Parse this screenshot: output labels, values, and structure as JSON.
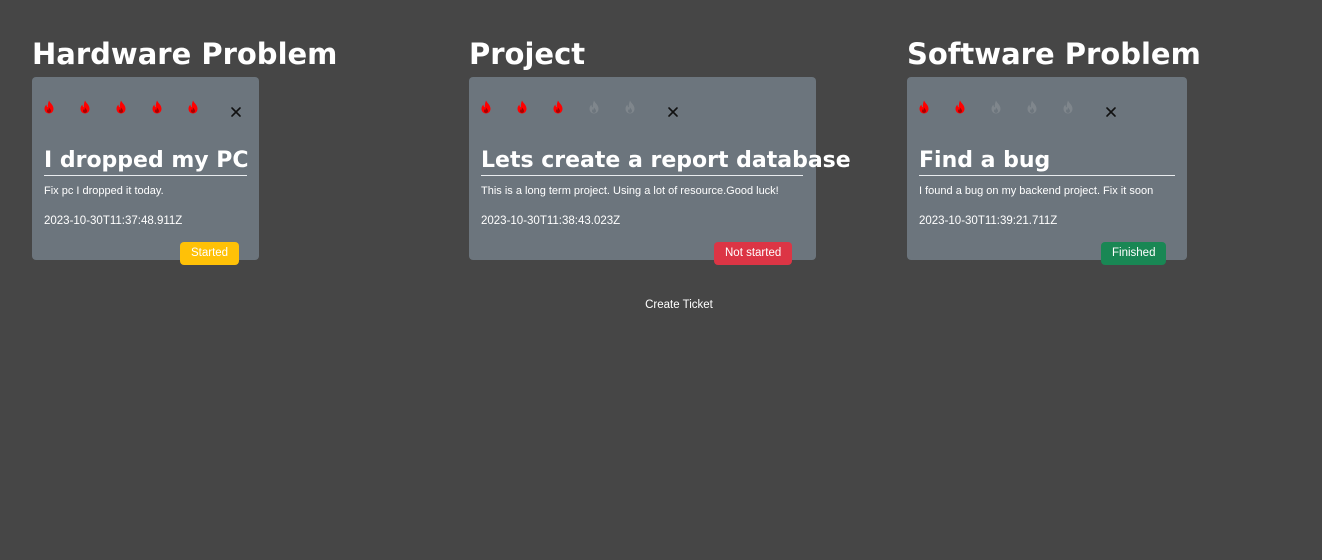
{
  "columns": [
    {
      "title": "Hardware Problem",
      "ticket": {
        "title": "I dropped my PC",
        "description": "Fix pc I dropped it today.",
        "date": "2023-10-30T11:37:48.911Z",
        "status": "Started",
        "priority": 5,
        "max_priority": 5
      }
    },
    {
      "title": "Project",
      "ticket": {
        "title": "Lets create a report database",
        "description": "This is a long term project. Using a lot of resource.Good luck!",
        "date": "2023-10-30T11:38:43.023Z",
        "status": "Not started",
        "priority": 3,
        "max_priority": 5
      }
    },
    {
      "title": "Software Problem",
      "ticket": {
        "title": "Find a bug",
        "description": "I found a bug on my backend project. Fix it soon",
        "date": "2023-10-30T11:39:21.711Z",
        "status": "Finished",
        "priority": 2,
        "max_priority": 5
      }
    }
  ],
  "icons": {
    "priority": "flame-icon",
    "close": "close-icon"
  },
  "colors": {
    "background": "#464646",
    "card": "#6c757d",
    "flame_active": "#ff0000",
    "flame_inactive": "#7f868c",
    "status_started": "#ffc107",
    "status_not_started": "#dc3545",
    "status_finished": "#198754"
  },
  "create_ticket_label": "Create Ticket"
}
